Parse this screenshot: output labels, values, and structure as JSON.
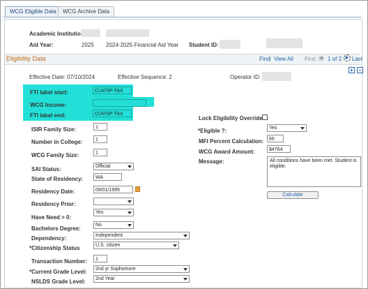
{
  "tabs": [
    "WCG Eligible Data",
    "WCG Archive Data"
  ],
  "header": {
    "institution_label": "Academic Institution:",
    "aid_year_label": "Aid Year:",
    "aid_year": "2025",
    "aid_year_desc": "2024-2025 Financial Aid Year",
    "student_id_label": "Student ID:"
  },
  "section": {
    "title": "Eligibility Data",
    "find": "Find",
    "view_all": "View All",
    "first": "First",
    "position": "1 of 2",
    "last": "Last"
  },
  "meta": {
    "effective_date": "Effective Date:  07/10/2024",
    "effective_seq": "Effective Sequence:  2",
    "operator_label": "Operator ID:"
  },
  "fti": {
    "start_label": "FTI label start:",
    "start_value": "CUI//SP-TAX",
    "income_label": "WCG Income:",
    "end_label": "FTI label end:",
    "end_value": "CUI//SP-TAX"
  },
  "left": {
    "isir_label": "ISIR Family Size:",
    "isir_value": "1",
    "college_label": "Number in College:",
    "college_value": "1",
    "wcg_family_label": "WCG Family Size:",
    "wcg_family_value": "1",
    "sai_label": "SAI Status:",
    "sai_value": "Official",
    "state_label": "State of Residency:",
    "state_value": "WA",
    "res_date_label": "Residency Date:",
    "res_date_value": "09/01/1995",
    "res_prior_label": "Residency Prior:",
    "res_prior_value": "",
    "need_label": "Have Need > 0:",
    "need_value": "Yes",
    "bach_label": "Bachelors Degree:",
    "bach_value": "No",
    "dependency_label": "Dependency:",
    "dependency_value": "Independent",
    "citizen_label": "*Citizenship Status",
    "citizen_value": "U.S. citizen",
    "trans_label": "Transaction Number:",
    "trans_value": "1",
    "grade_label": "*Current Grade Level:",
    "grade_value": "2nd yr Sophomore",
    "nslds_label": "NSLDS Grade Level:",
    "nslds_value": "2nd Year"
  },
  "right": {
    "lock_label": "Lock Eligibility Override:",
    "eligible_label": "*Eligible ?:",
    "eligible_value": "Yes",
    "mfi_label": "MFI Percent Calculation:",
    "mfi_value": "65",
    "award_label": "WCG Award Amount:",
    "award_value": "$4764",
    "message_label": "Message:",
    "message_value": "All conditions have been met.  Student is eligible.",
    "calculate_label": "Calculate"
  },
  "colors": {
    "highlight": "#22e0d8",
    "section_title": "#c46b1b",
    "link": "#1f5fa8"
  }
}
